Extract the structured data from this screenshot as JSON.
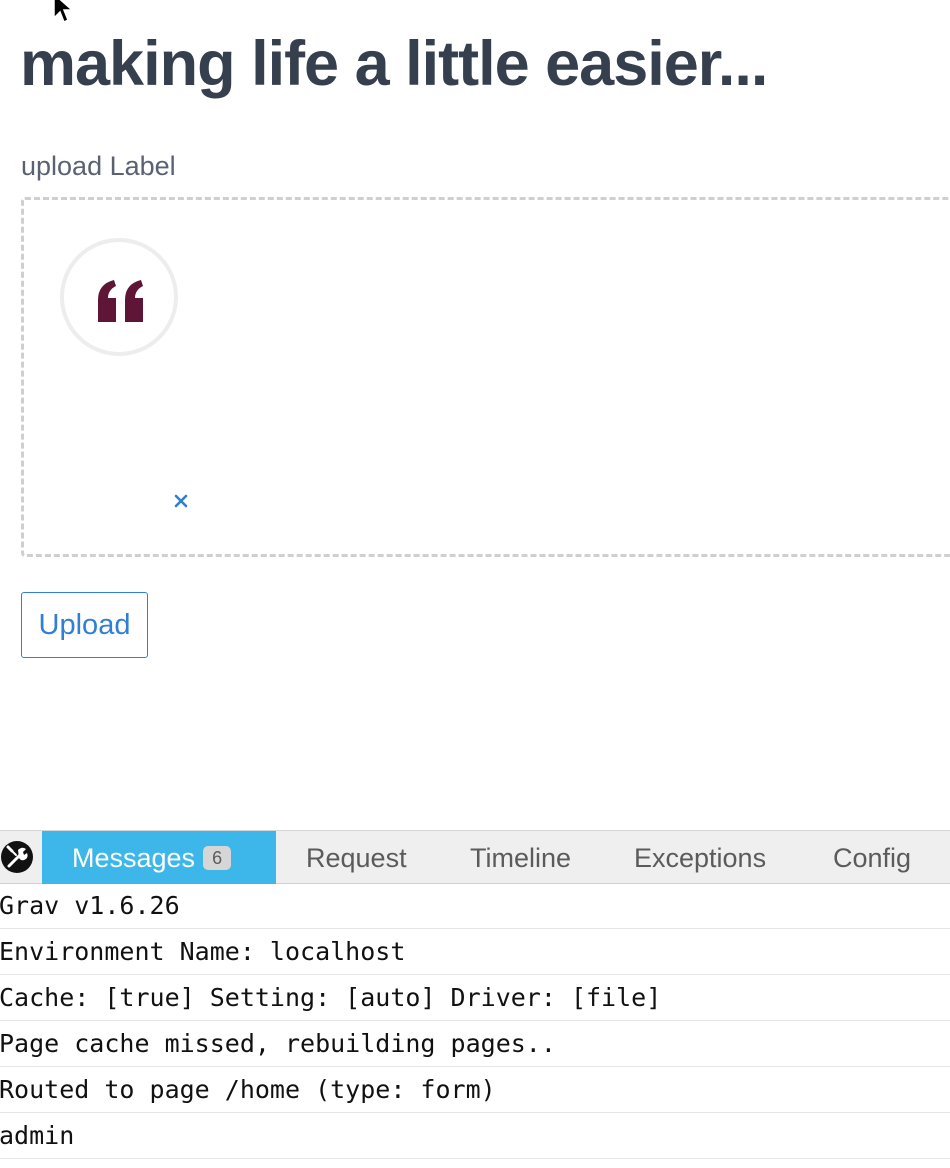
{
  "page": {
    "title": "making life a little easier..."
  },
  "upload": {
    "label": "upload Label",
    "remove_glyph": "×",
    "button_label": "Upload"
  },
  "icons": {
    "cursor": "mouse-pointer-icon",
    "thumbnail": "quote-mark-icon",
    "remove": "close-icon",
    "debugbar_logo": "wrench-icon"
  },
  "colors": {
    "accent": "#2f7fd6",
    "active_tab": "#3db7ea",
    "title": "#363f4e",
    "quote_mark": "#5e1536"
  },
  "debugbar": {
    "tabs": [
      {
        "label": "Messages",
        "badge": "6",
        "active": true
      },
      {
        "label": "Request"
      },
      {
        "label": "Timeline"
      },
      {
        "label": "Exceptions"
      },
      {
        "label": "Config"
      }
    ],
    "messages": [
      "Grav v1.6.26",
      "Environment Name: localhost",
      "Cache: [true] Setting: [auto] Driver: [file]",
      "Page cache missed, rebuilding pages..",
      "Routed to page /home (type: form)",
      "admin"
    ]
  }
}
